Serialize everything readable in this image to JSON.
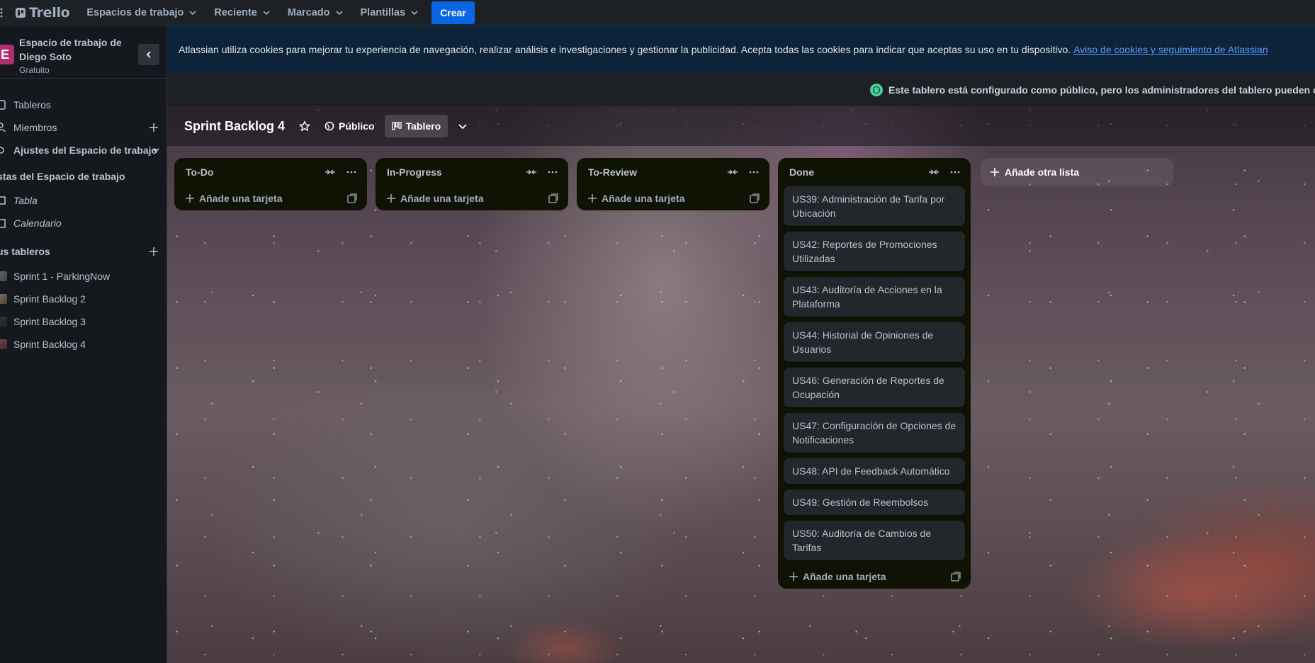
{
  "topbar": {
    "logo": "Trello",
    "nav": [
      {
        "label": "Espacios de trabajo"
      },
      {
        "label": "Reciente"
      },
      {
        "label": "Marcado"
      },
      {
        "label": "Plantillas"
      }
    ],
    "create_label": "Crear",
    "create_color": "#0c66e4"
  },
  "sidebar": {
    "avatar_letter": "E",
    "avatar_color": "#ae2e6f",
    "workspace_name": "Espacio de trabajo de Diego Soto",
    "plan": "Gratuito",
    "items": [
      {
        "label": "Tableros"
      },
      {
        "label": "Miembros"
      },
      {
        "label": "Ajustes del Espacio de trabajo"
      }
    ],
    "views_heading": "stas del Espacio de trabajo",
    "views": [
      {
        "label": "Tabla"
      },
      {
        "label": "Calendario"
      }
    ],
    "boards_heading": "us tableros",
    "boards": [
      {
        "label": "Sprint 1 - ParkingNow"
      },
      {
        "label": "Sprint Backlog 2"
      },
      {
        "label": "Sprint Backlog 3"
      },
      {
        "label": "Sprint Backlog 4"
      }
    ]
  },
  "cookie_banner": {
    "text": "Atlassian utiliza cookies para mejorar tu experiencia de navegación, realizar análisis e investigaciones y gestionar la publicidad. Acepta todas las cookies para indicar que aceptas su uso en tu dispositivo.",
    "link": "Aviso de cookies y seguimiento de Atlassian"
  },
  "notice": {
    "text": "Este tablero está configurado como público, pero los administradores del tablero pueden camb"
  },
  "board": {
    "title": "Sprint Backlog 4",
    "visibility": "Público",
    "view": "Tablero",
    "lists": [
      {
        "title": "To-Do",
        "add_label": "Añade una tarjeta",
        "cards": []
      },
      {
        "title": "In-Progress",
        "add_label": "Añade una tarjeta",
        "cards": []
      },
      {
        "title": "To-Review",
        "add_label": "Añade una tarjeta",
        "cards": []
      },
      {
        "title": "Done",
        "add_label": "Añade una tarjeta",
        "cards": [
          "US39: Administración de Tarifa por Ubicación",
          "US42: Reportes de Promociones Utilizadas",
          "US43: Auditoría de Acciones en la Plataforma",
          "US44: Historial de Opiniones de Usuarios",
          "US46: Generación de Reportes de Ocupación",
          "US47: Configuración de Opciones de Notificaciones",
          "US48: API de Feedback Automático",
          "US49: Gestión de Reembolsos",
          "US50: Auditoría de Cambios de Tarifas"
        ]
      }
    ],
    "add_list_label": "Añade otra lista"
  }
}
